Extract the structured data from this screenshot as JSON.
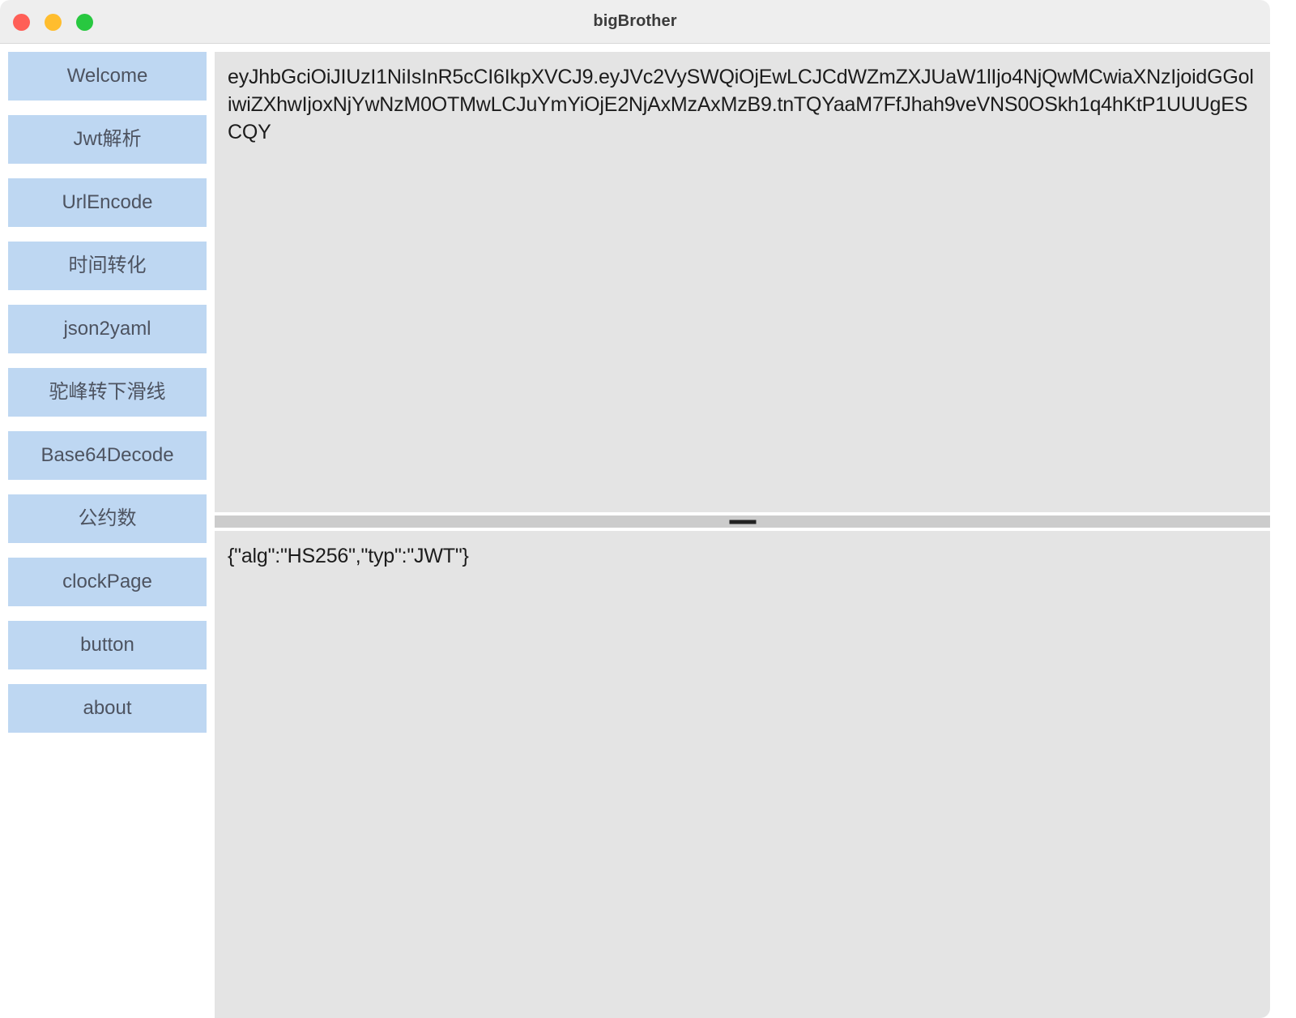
{
  "window": {
    "title": "bigBrother",
    "controls": [
      {
        "name": "close",
        "color": "#ff5f57"
      },
      {
        "name": "minimize",
        "color": "#ffbd2e"
      },
      {
        "name": "zoom",
        "color": "#28c840"
      }
    ]
  },
  "sidebar": {
    "items": [
      {
        "id": "welcome",
        "label": "Welcome"
      },
      {
        "id": "jwt-parse",
        "label": "Jwt解析"
      },
      {
        "id": "url-encode",
        "label": "UrlEncode"
      },
      {
        "id": "time-convert",
        "label": "时间转化"
      },
      {
        "id": "json2yaml",
        "label": "json2yaml"
      },
      {
        "id": "camel-to-snake",
        "label": "驼峰转下滑线"
      },
      {
        "id": "base64-decode",
        "label": "Base64Decode"
      },
      {
        "id": "gcd",
        "label": "公约数"
      },
      {
        "id": "clock-page",
        "label": "clockPage"
      },
      {
        "id": "button",
        "label": "button"
      },
      {
        "id": "about",
        "label": "about"
      }
    ]
  },
  "main": {
    "token_input": "eyJhbGciOiJIUzI1NiIsInR5cCI6IkpXVCJ9.eyJVc2VySWQiOjEwLCJCdWZmZXJUaW1lIjo4NjQwMCwiaXNzIjoidGGoliwiZXhwIjoxNjYwNzM0OTMwLCJuYmYiOjE2NjAxMzAxMzB9.tnTQYaaM7FfJhah9veVNS0OSkh1q4hKtP1UUUgESCQY",
    "decoded_output": "{\"alg\":\"HS256\",\"typ\":\"JWT\"}",
    "splitter_handle": "splitter-handle"
  },
  "colors": {
    "titlebar_bg": "#eeeeee",
    "pane_bg": "#e4e4e4",
    "nav_button_bg": "#bed7f2",
    "nav_button_text": "#4d5360",
    "splitter_bg": "#cccccc",
    "text": "#1c1c1c"
  }
}
